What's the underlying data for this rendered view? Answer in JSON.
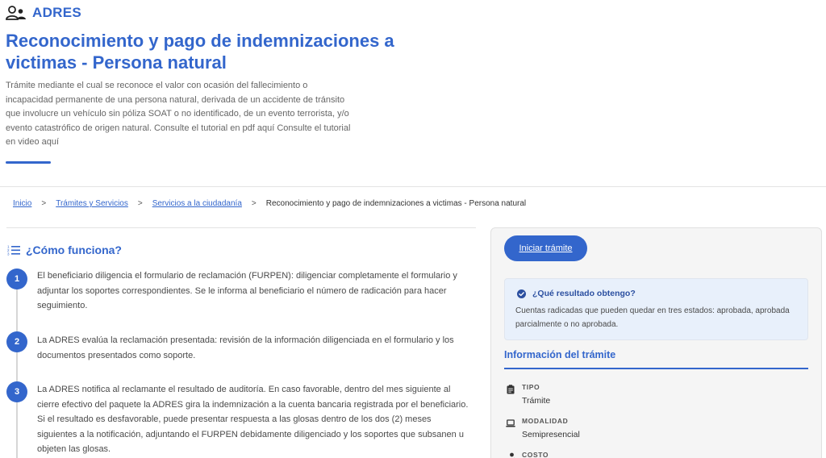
{
  "header": {
    "brand": "ADRES",
    "title": "Reconocimiento y pago de indemnizaciones a victimas - Persona natural",
    "description": "Trámite mediante el cual se reconoce el valor con ocasión del fallecimiento o incapacidad permanente de una persona natural, derivada de un accidente de tránsito que involucre un vehículo sin póliza SOAT o no identificado, de un evento terrorista, y/o evento catastrófico de origen natural. Consulte el tutorial en pdf aquí Consulte el tutorial en video aquí"
  },
  "breadcrumb": {
    "items": [
      "Inicio",
      "Trámites y Servicios",
      "Servicios a la ciudadanía"
    ],
    "current": "Reconocimiento y pago de indemnizaciones a victimas - Persona natural",
    "separator": ">"
  },
  "how_it_works": {
    "heading": "¿Cómo funciona?",
    "steps": [
      {
        "number": "1",
        "text": "El beneficiario diligencia el formulario de reclamación (FURPEN): diligenciar completamente el formulario y adjuntar los soportes correspondientes. Se le informa al beneficiario el número de radicación para hacer seguimiento."
      },
      {
        "number": "2",
        "text": "La ADRES evalúa la reclamación presentada: revisión de la información diligenciada en el formulario y los documentos presentados como soporte."
      },
      {
        "number": "3",
        "text": "La ADRES notifica al reclamante el resultado de auditoría. En caso favorable, dentro del mes siguiente al cierre efectivo del paquete la ADRES gira la indemnización a la cuenta bancaria registrada por el beneficiario. Si el resultado es desfavorable, puede presentar respuesta a las glosas dentro de los dos (2) meses siguientes a la notificación, adjuntando el FURPEN debidamente diligenciado y los soportes que subsanen u objeten las glosas."
      }
    ]
  },
  "side_panel": {
    "start_button": "Iniciar trámite",
    "result": {
      "title": "¿Qué resultado obtengo?",
      "text": "Cuentas radicadas que pueden quedar en tres estados: aprobada, aprobada parcialmente o no aprobada."
    },
    "info": {
      "title": "Información del trámite",
      "items": [
        {
          "icon": "clipboard-icon",
          "label": "TIPO",
          "value": "Trámite"
        },
        {
          "icon": "laptop-icon",
          "label": "MODALIDAD",
          "value": "Semipresencial"
        },
        {
          "icon": "hand-coin-icon",
          "label": "COSTO",
          "value": ""
        }
      ]
    }
  },
  "colors": {
    "primary": "#3366cc",
    "panel_bg": "#f5f5f5",
    "result_bg": "#e8f0fb"
  }
}
